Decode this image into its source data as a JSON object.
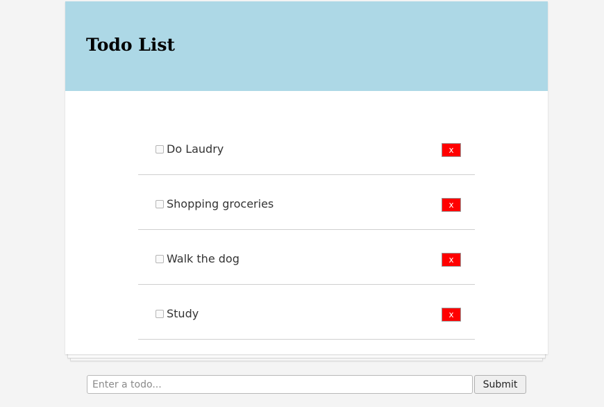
{
  "header": {
    "title": "Todo List"
  },
  "todos": [
    {
      "label": "Do Laudry",
      "checked": false,
      "delete_label": "x"
    },
    {
      "label": "Shopping groceries",
      "checked": false,
      "delete_label": "x"
    },
    {
      "label": "Walk the dog",
      "checked": false,
      "delete_label": "x"
    },
    {
      "label": "Study",
      "checked": false,
      "delete_label": "x"
    }
  ],
  "form": {
    "placeholder": "Enter a todo...",
    "value": "",
    "submit_label": "Submit"
  },
  "colors": {
    "header_bg": "#add8e6",
    "delete_bg": "#ff0000",
    "page_bg": "#f4f4f4"
  }
}
